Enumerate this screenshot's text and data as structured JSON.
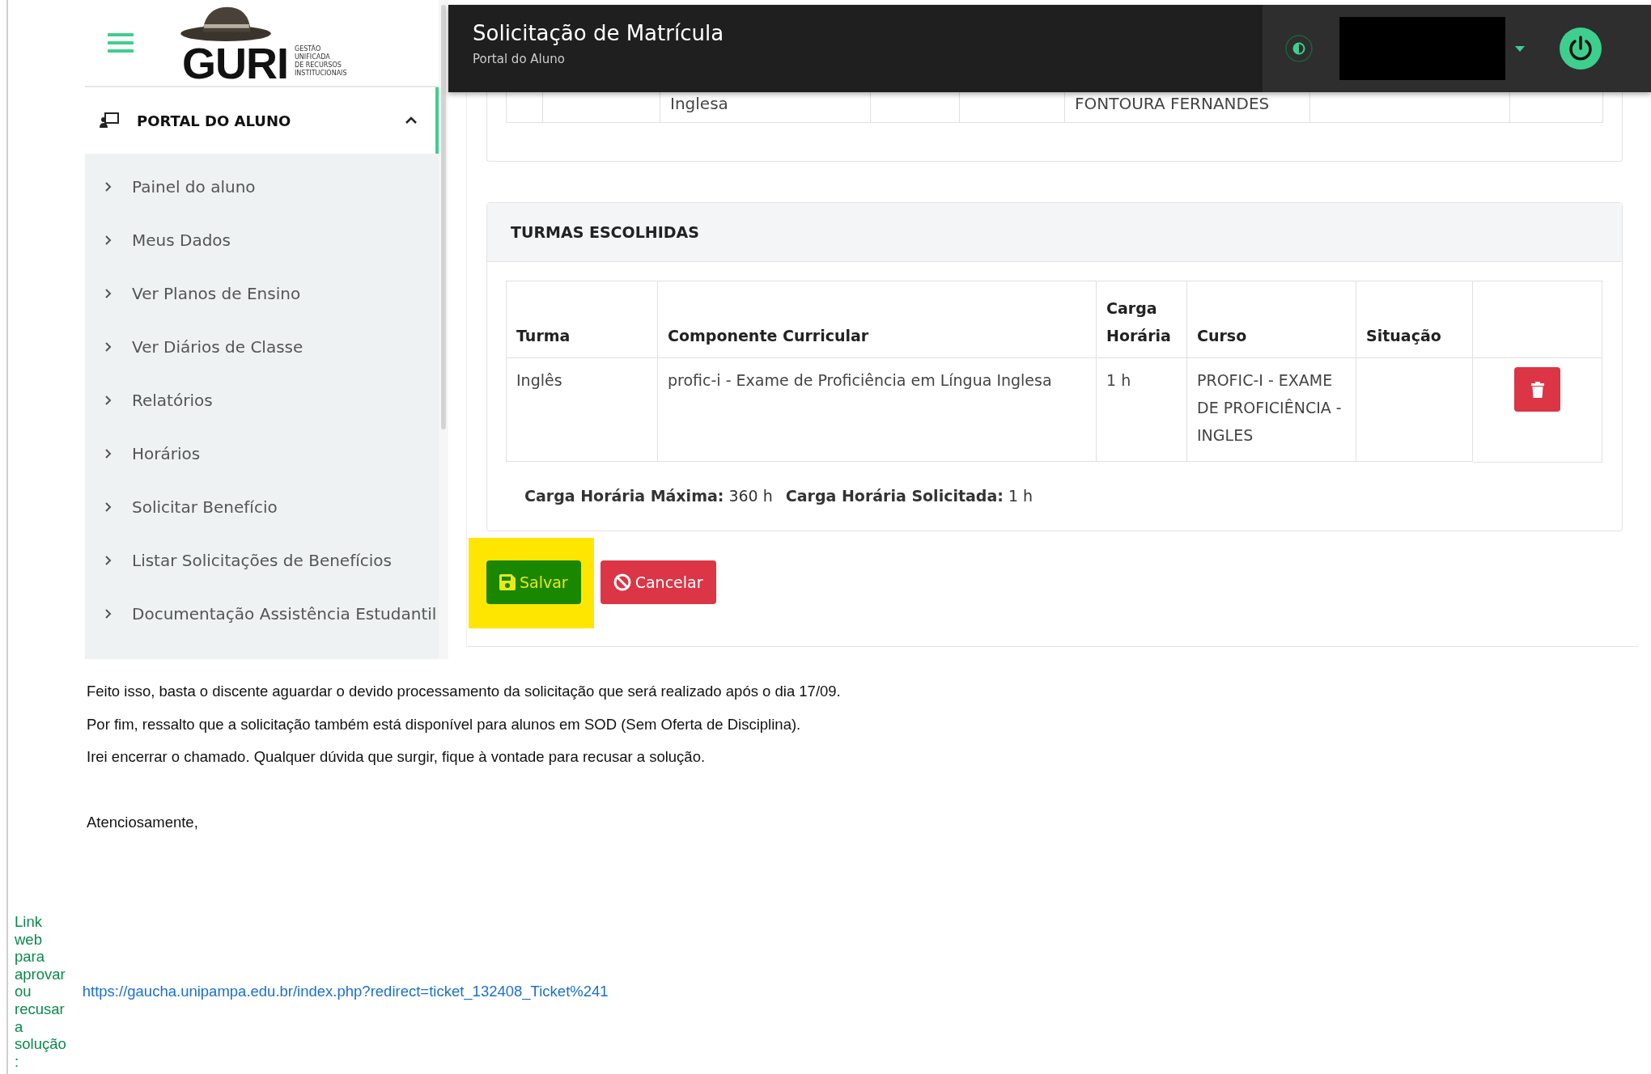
{
  "app_screenshot": {
    "logo": {
      "wordmark": "GURI",
      "tagline": [
        "GESTÃO",
        "UNIFICADA",
        "DE RECURSOS",
        "INSTITUCIONAIS"
      ]
    },
    "sidebar": {
      "section": {
        "label": "PORTAL DO ALUNO",
        "expanded": true
      },
      "items": [
        "Painel do aluno",
        "Meus Dados",
        "Ver Planos de Ensino",
        "Ver Diários de Classe",
        "Relatórios",
        "Horários",
        "Solicitar Benefício",
        "Listar Solicitações de Benefícios",
        "Documentação Assistência Estudantil"
      ]
    },
    "header": {
      "title": "Solicitação de Matrícula",
      "subtitle": "Portal do Aluno"
    },
    "partial_row": {
      "column_3": "Inglesa",
      "column_6": "FONTOURA FERNANDES"
    },
    "chosen_classes": {
      "title": "TURMAS ESCOLHIDAS",
      "columns": [
        "Turma",
        "Componente Curricular",
        "Carga Horária",
        "Curso",
        "Situação"
      ],
      "rows": [
        {
          "cells": [
            "Inglês",
            "profic-i - Exame de Proficiência em Língua Inglesa",
            "1 h",
            "PROFIC-I - EXAME DE PROFICIÊNCIA - INGLES"
          ]
        }
      ],
      "summary": [
        "**Carga Horária Máxima:** 360 h",
        "**Carga Horária Solicitada:** 1 h"
      ]
    },
    "actions": [
      {
        "label": "Salvar",
        "kind": "save",
        "highlighted": true
      },
      {
        "label": "Cancelar",
        "kind": "cancel",
        "highlighted": false
      }
    ]
  },
  "message": {
    "paragraphs": [
      "Feito isso, basta o discente aguardar o devido processamento da solicitação que será realizado após o dia 17/09.",
      "Por fim, ressalto que a solicitação também está disponível para alunos em SOD (Sem Oferta de Disciplina).",
      "Irei encerrar o chamado. Qualquer dúvida que surgir, fique à vontade para recusar a solução."
    ],
    "closing": "Atenciosamente,"
  },
  "footer_link": {
    "label": "Link web para aprovar ou recusar a solução :",
    "url": "https://gaucha.unipampa.edu.br/index.php?redirect=ticket_132408_Ticket%241"
  }
}
